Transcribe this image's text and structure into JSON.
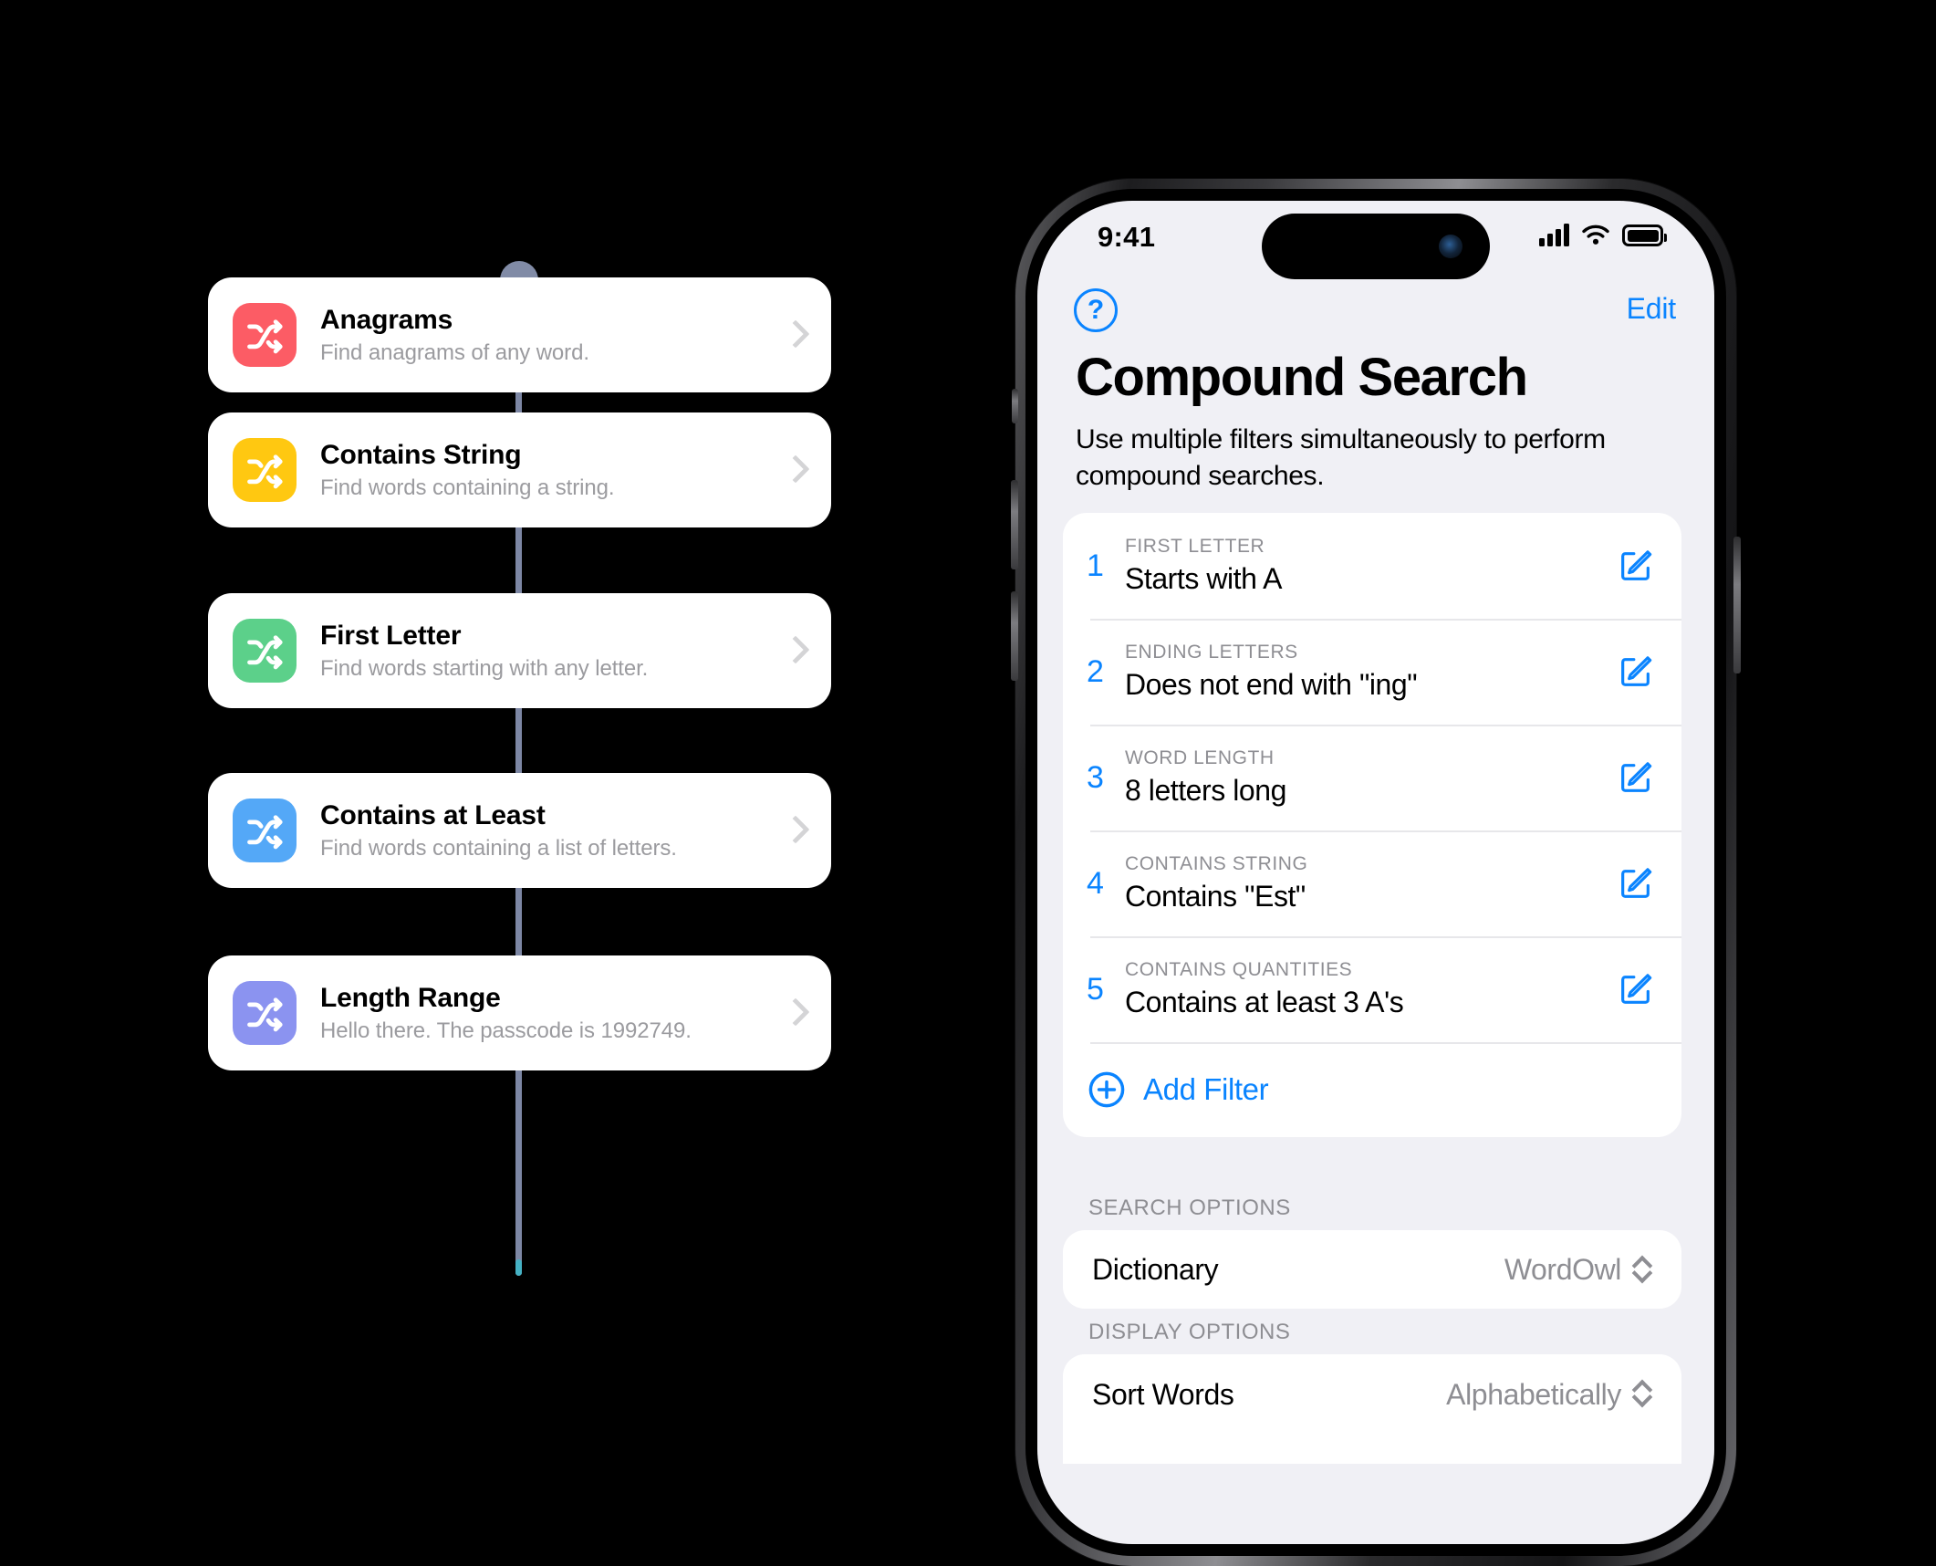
{
  "timeline": {
    "cards": [
      {
        "title": "Anagrams",
        "subtitle": "Find anagrams of any word.",
        "color": "#fc5c65",
        "icon": "shuffle-icon"
      },
      {
        "title": "Contains String",
        "subtitle": "Find words containing a string.",
        "color": "#ffc811",
        "icon": "shuffle-icon"
      },
      {
        "title": "First Letter",
        "subtitle": "Find words starting with any letter.",
        "color": "#5cd08a",
        "icon": "shuffle-icon"
      },
      {
        "title": "Contains at Least",
        "subtitle": "Find words containing a list of letters.",
        "color": "#54a8f7",
        "icon": "shuffle-icon"
      },
      {
        "title": "Length Range",
        "subtitle": "Hello there. The passcode is 1992749.",
        "color": "#8b93f0",
        "icon": "shuffle-icon"
      }
    ]
  },
  "phone": {
    "status_bar": {
      "time": "9:41",
      "signal_icon": "cellular-bars-icon",
      "wifi_icon": "wifi-icon",
      "battery_icon": "battery-full-icon"
    },
    "nav": {
      "help_label": "?",
      "edit_label": "Edit"
    },
    "header": {
      "title": "Compound Search",
      "subtitle": "Use multiple filters simultaneously to perform compound searches."
    },
    "filters": [
      {
        "number": "1",
        "category": "FIRST LETTER",
        "value": "Starts with A",
        "edit_icon": "edit-square-pencil-icon"
      },
      {
        "number": "2",
        "category": "ENDING LETTERS",
        "value": "Does not end with \"ing\"",
        "edit_icon": "edit-square-pencil-icon"
      },
      {
        "number": "3",
        "category": "WORD LENGTH",
        "value": "8 letters long",
        "edit_icon": "edit-square-pencil-icon"
      },
      {
        "number": "4",
        "category": "CONTAINS STRING",
        "value": "Contains \"Est\"",
        "edit_icon": "edit-square-pencil-icon"
      },
      {
        "number": "5",
        "category": "CONTAINS QUANTITIES",
        "value": "Contains at least 3 A's",
        "edit_icon": "edit-square-pencil-icon"
      }
    ],
    "add_filter": {
      "label": "Add Filter",
      "icon": "plus-circle-icon"
    },
    "search_options": {
      "header": "SEARCH OPTIONS",
      "dictionary_label": "Dictionary",
      "dictionary_value": "WordOwl"
    },
    "display_options": {
      "header": "DISPLAY OPTIONS",
      "sort_label": "Sort Words",
      "sort_value": "Alphabetically"
    }
  },
  "colors": {
    "accent": "#0a84ff",
    "screen_bg": "#f0f0f5",
    "timeline": "#7d87a4"
  }
}
